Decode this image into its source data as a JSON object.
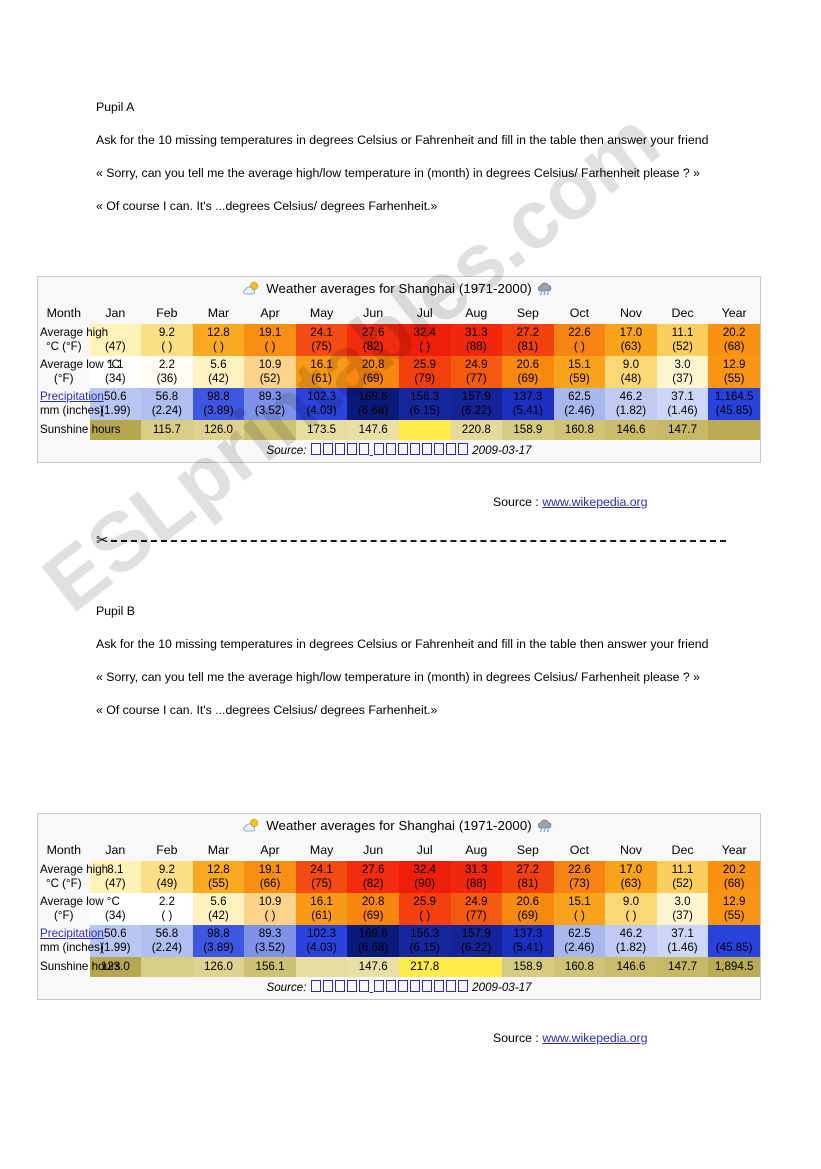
{
  "watermark": "ESLprintables.com",
  "source_note": "Source : ",
  "source_link": "www.wikepedia.org",
  "sections": [
    {
      "heading": "Pupil A",
      "instruction": "Ask for the 10 missing temperatures in degrees Celsius or Fahrenheit and fill in the table then answer your friend",
      "line_ask": "« Sorry, can you tell me the average high/low temperature in (month) in degrees Celsius/ Farhenheit please ? »",
      "line_answer": "« Of course I can. It's ...degrees Celsius/ degrees Farhenheit.»"
    },
    {
      "heading": "Pupil B",
      "instruction": " Ask for the 10 missing temperatures in degrees Celsius or Fahrenheit and fill in the table then answer your friend",
      "line_ask": "« Sorry, can you tell me the average high/low temperature in (month) in degrees Celsius/ Farhenheit please ? »",
      "line_answer": "« Of course I can. It's ...degrees Celsius/ degrees Farhenheit.»"
    }
  ],
  "table": {
    "title": "Weather averages for Shanghai (1971-2000)",
    "icon_left": "sun-behind-cloud-icon",
    "icon_right": "rain-cloud-icon",
    "month_label": "Month",
    "months": [
      "Jan",
      "Feb",
      "Mar",
      "Apr",
      "May",
      "Jun",
      "Jul",
      "Aug",
      "Sep",
      "Oct",
      "Nov",
      "Dec",
      "Year"
    ],
    "row_labels": {
      "high": "Average high °C (°F)",
      "high_l1": "Average high",
      "high_l2": "°C (°F)",
      "low_l1": "Average low °C",
      "low_l2": "(°F)",
      "precip_l1": "Precipitation",
      "precip_l2": "mm (inches)",
      "sunshine": "Sunshine hours"
    },
    "source_prefix": "Source:",
    "source_date": "2009-03-17"
  },
  "chart_data": {
    "type": "table",
    "title": "Weather averages for Shanghai (1971-2000)",
    "categories": [
      "Jan",
      "Feb",
      "Mar",
      "Apr",
      "May",
      "Jun",
      "Jul",
      "Aug",
      "Sep",
      "Oct",
      "Nov",
      "Dec",
      "Year"
    ],
    "tables": [
      {
        "name": "Pupil A",
        "rows": [
          {
            "label": "Average high °C (°F)",
            "celsius": [
              "",
              "9.2",
              "12.8",
              "19.1",
              "24.1",
              "27.6",
              "32.4",
              "31.3",
              "27.2",
              "22.6",
              "17.0",
              "11.1",
              "20.2"
            ],
            "fahrenheit": [
              "(47)",
              "(    )",
              "(    )",
              "(    )",
              "(75)",
              "(82)",
              "(    )",
              "(88)",
              "(81)",
              "(    )",
              "(63)",
              "(52)",
              "(68)"
            ],
            "colors": [
              "#fdf3b8",
              "#fbdf86",
              "#f9aa1e",
              "#f98f12",
              "#f44b12",
              "#f22c0e",
              "#ee1f0a",
              "#f0270c",
              "#f2400f",
              "#f78312",
              "#f9a41a",
              "#fbce5e",
              "#f99213"
            ]
          },
          {
            "label": "Average low °C (°F)",
            "celsius": [
              "1.1",
              "2.2",
              "5.6",
              "10.9",
              "16.1",
              "20.8",
              "25.9",
              "24.9",
              "20.6",
              "15.1",
              "9.0",
              "3.0",
              "12.9"
            ],
            "fahrenheit": [
              "(34)",
              "(36)",
              "(42)",
              "(52)",
              "(61)",
              "(69)",
              "(79)",
              "(77)",
              "(69)",
              "(59)",
              "(48)",
              "(37)",
              "(55)"
            ],
            "colors": [
              "#ffffff",
              "#fffdf4",
              "#fdf2c0",
              "#fbd38a",
              "#f99a16",
              "#f8860f",
              "#f4400f",
              "#f55b10",
              "#f8890f",
              "#f9a31a",
              "#fbd776",
              "#fdf6d0",
              "#f99512"
            ]
          },
          {
            "label": "Precipitation mm (inches)",
            "mm": [
              "50.6",
              "56.8",
              "98.8",
              "89.3",
              "102.3",
              "169.6",
              "156.3",
              "157.9",
              "137.3",
              "62.5",
              "46.2",
              "37.1",
              "1,164.5"
            ],
            "inches": [
              "(1.99)",
              "(2.24)",
              "(3.89)",
              "(3.52)",
              "(4.03)",
              "(6.68)",
              "(6.15)",
              "(6.22)",
              "(5.41)",
              "(2.46)",
              "(1.82)",
              "(1.46)",
              "(45.85)"
            ],
            "colors": [
              "#b9c6f2",
              "#b0bff0",
              "#3f56e0",
              "#7e92ea",
              "#2b43dc",
              "#0a1a7a",
              "#16279e",
              "#142398",
              "#1d2fc0",
              "#a8b8ee",
              "#c0cbf4",
              "#ccd6f7",
              "#2a42dc"
            ]
          },
          {
            "label": "Sunshine hours",
            "values": [
              "",
              "115.7",
              "126.0",
              "",
              "173.5",
              "147.6",
              "",
              "220.8",
              "158.9",
              "160.8",
              "146.6",
              "147.7",
              ""
            ],
            "colors": [
              "#b5a74f",
              "#d8ce86",
              "#ddd391",
              "#cdc173",
              "#e6dd9f",
              "#e9e0a6",
              "#ffeb4a",
              "#e4da9c",
              "#d6cb83",
              "#cfc476",
              "#c9bd6c",
              "#c5b966",
              "#b9ac55"
            ]
          }
        ]
      },
      {
        "name": "Pupil B",
        "rows": [
          {
            "label": "Average high °C (°F)",
            "celsius": [
              "8.1",
              "9.2",
              "12.8",
              "19.1",
              "24.1",
              "27.6",
              "32.4",
              "31.3",
              "27.2",
              "22.6",
              "17.0",
              "11.1",
              "20.2"
            ],
            "fahrenheit": [
              "(47)",
              "(49)",
              "(55)",
              "(66)",
              "(75)",
              "(82)",
              "(90)",
              "(88)",
              "(81)",
              "(73)",
              "(63)",
              "(52)",
              "(68)"
            ],
            "colors": [
              "#fdf3b8",
              "#fbdf86",
              "#f9aa1e",
              "#f98f12",
              "#f44b12",
              "#f22c0e",
              "#ee1f0a",
              "#f0270c",
              "#f2400f",
              "#f78312",
              "#f9a41a",
              "#fbce5e",
              "#f99213"
            ]
          },
          {
            "label": "Average low °C (°F)",
            "celsius": [
              "",
              "2.2",
              "5.6",
              "10.9",
              "16.1",
              "20.8",
              "25.9",
              "24.9",
              "20.6",
              "15.1",
              "9.0",
              "3.0",
              "12.9"
            ],
            "fahrenheit": [
              "(34)",
              "(    )",
              "(42)",
              "(    )",
              "(61)",
              "(69)",
              "(    )",
              "(77)",
              "(69)",
              "(    )",
              "(    )",
              "(37)",
              "(55)"
            ],
            "colors": [
              "#ffffff",
              "#ffffff",
              "#fdf2c0",
              "#fbd38a",
              "#f99a16",
              "#f8860f",
              "#f4400f",
              "#f55b10",
              "#f8890f",
              "#f9a31a",
              "#fbd776",
              "#fdf6d0",
              "#f99512"
            ]
          },
          {
            "label": "Precipitation mm (inches)",
            "mm": [
              "50.6",
              "56.8",
              "98.8",
              "89.3",
              "102.3",
              "169.6",
              "156.3",
              "157.9",
              "137.3",
              "62.5",
              "46.2",
              "37.1",
              ""
            ],
            "inches": [
              "(1.99)",
              "(2.24)",
              "(3.89)",
              "(3.52)",
              "(4.03)",
              "(6.68)",
              "(6.15)",
              "(6.22)",
              "(5.41)",
              "(2.46)",
              "(1.82)",
              "(1.46)",
              "(45.85)"
            ],
            "colors": [
              "#b9c6f2",
              "#b0bff0",
              "#3f56e0",
              "#7e92ea",
              "#2b43dc",
              "#0a1a7a",
              "#16279e",
              "#142398",
              "#1d2fc0",
              "#a8b8ee",
              "#c0cbf4",
              "#ccd6f7",
              "#2a42dc"
            ]
          },
          {
            "label": "Sunshine hours",
            "values": [
              "123.0",
              "",
              "126.0",
              "156.1",
              "",
              "147.6",
              "217.8",
              "",
              "158.9",
              "160.8",
              "146.6",
              "147.7",
              "1,894.5"
            ],
            "colors": [
              "#b5a74f",
              "#d8ce86",
              "#ddd391",
              "#cdc173",
              "#e6dd9f",
              "#e9e0a6",
              "#ffeb4a",
              "#ffeb4a",
              "#d6cb83",
              "#cfc476",
              "#c9bd6c",
              "#c5b966",
              "#b9ac55"
            ]
          }
        ]
      }
    ]
  }
}
